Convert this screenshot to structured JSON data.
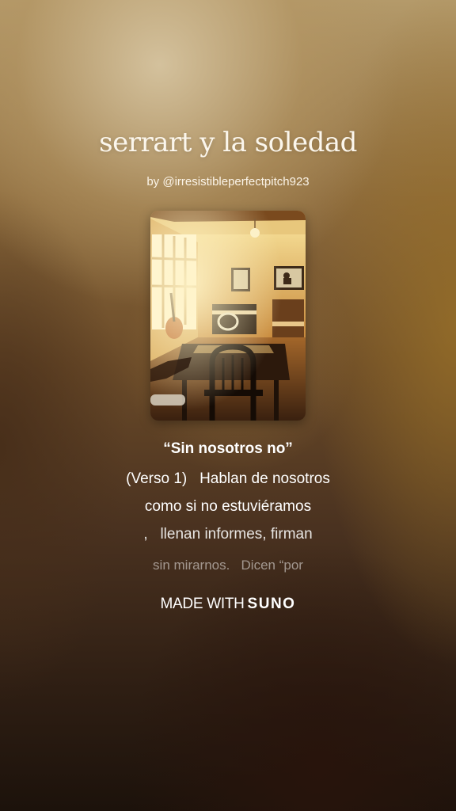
{
  "song": {
    "title": "serrart y la soledad",
    "byline": "by @irresistibleperfectpitch923",
    "cover_alt": "sunlit music room with piano, guitar and chair"
  },
  "lyrics": {
    "heading": "“Sin nosotros no”",
    "lines": [
      "(Verso 1)   Hablan de nosotros",
      "como si no estuviéramos",
      ",   llenan informes, firman",
      "sin mirarnos.   Dicen “por"
    ]
  },
  "footer": {
    "made_with": "MADE WITH",
    "brand": "SUNO"
  },
  "colors": {
    "title": "#fbf6ec",
    "text": "#ffffff",
    "bg_top": "#b49a6a",
    "bg_bottom": "#1c120b"
  }
}
